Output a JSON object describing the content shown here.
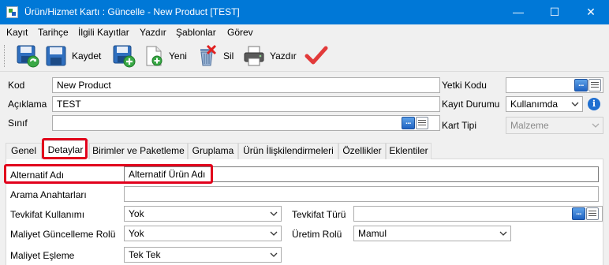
{
  "window": {
    "title": "Ürün/Hizmet Kartı : Güncelle - New Product [TEST]",
    "minimize": "—",
    "maximize": "☐",
    "close": "✕"
  },
  "menu": [
    "Kayıt",
    "Tarihçe",
    "İlgili Kayıtlar",
    "Yazdır",
    "Şablonlar",
    "Görev"
  ],
  "toolbar": {
    "save_label": "Kaydet",
    "new_label": "Yeni",
    "delete_label": "Sil",
    "print_label": "Yazdır"
  },
  "form": {
    "kod_label": "Kod",
    "kod_value": "New Product",
    "aciklama_label": "Açıklama",
    "aciklama_value": "TEST",
    "sinif_label": "Sınıf",
    "sinif_value": "",
    "yetki_kodu_label": "Yetki Kodu",
    "yetki_kodu_value": "",
    "kayit_durumu_label": "Kayıt Durumu",
    "kayit_durumu_value": "Kullanımda",
    "kart_tipi_label": "Kart Tipi",
    "kart_tipi_value": "Malzeme",
    "dots": "...",
    "info": "i"
  },
  "tabs": [
    "Genel",
    "Detaylar",
    "Birimler ve Paketleme",
    "Gruplama",
    "Ürün İlişkilendirmeleri",
    "Özellikler",
    "Eklentiler"
  ],
  "active_tab": "Detaylar",
  "details": {
    "alternatif_adi_label": "Alternatif Adı",
    "alternatif_adi_value": "Alternatif Ürün Adı",
    "arama_label": "Arama Anahtarları",
    "arama_value": "",
    "tevkifat_kullanimi_label": "Tevkifat Kullanımı",
    "tevkifat_kullanimi_value": "Yok",
    "tevkifat_turu_label": "Tevkifat Türü",
    "tevkifat_turu_value": "",
    "maliyet_guncelleme_label": "Maliyet Güncelleme Rolü",
    "maliyet_guncelleme_value": "Yok",
    "uretim_rolu_label": "Üretim Rolü",
    "uretim_rolu_value": "Mamul",
    "maliyet_esleme_label": "Maliyet Eşleme",
    "maliyet_esleme_value": "Tek Tek"
  },
  "colors": {
    "titlebar": "#0078d7",
    "highlight": "#e1001c"
  }
}
